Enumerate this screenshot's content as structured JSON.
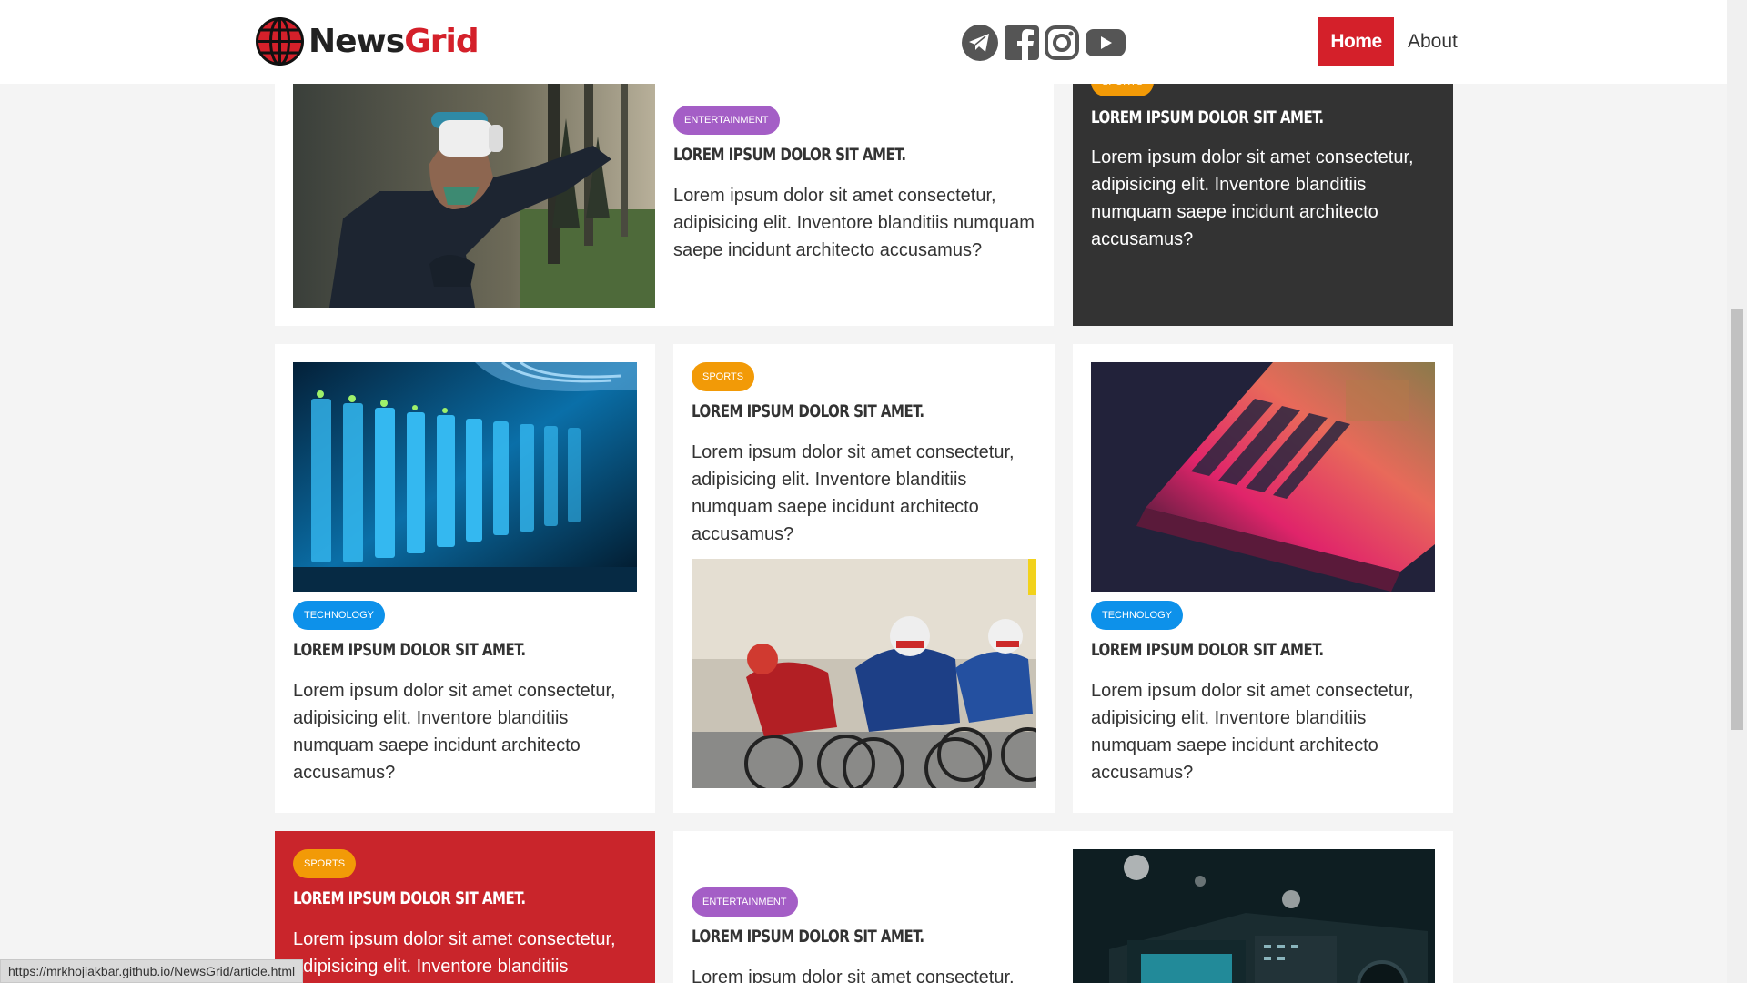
{
  "header": {
    "logo_news": "News",
    "logo_grid": "Grid",
    "nav": {
      "home": "Home",
      "about": "About"
    },
    "social": [
      "telegram-icon",
      "facebook-icon",
      "instagram-icon",
      "youtube-icon"
    ]
  },
  "cards": {
    "c1": {
      "category": "ENTERTAINMENT",
      "title": "LOREM IPSUM DOLOR SIT AMET.",
      "body": "Lorem ipsum dolor sit amet consectetur, adipisicing elit. Inventore blanditiis numquam saepe incidunt architecto accusamus?"
    },
    "c2": {
      "category": "SPORTS",
      "title": "LOREM IPSUM DOLOR SIT AMET.",
      "body": "Lorem ipsum dolor sit amet consectetur, adipisicing elit. Inventore blanditiis numquam saepe incidunt architecto accusamus?"
    },
    "c3": {
      "category": "TECHNOLOGY",
      "title": "LOREM IPSUM DOLOR SIT AMET.",
      "body": "Lorem ipsum dolor sit amet consectetur, adipisicing elit. Inventore blanditiis numquam saepe incidunt architecto accusamus?"
    },
    "c4": {
      "category": "SPORTS",
      "title": "LOREM IPSUM DOLOR SIT AMET.",
      "body": "Lorem ipsum dolor sit amet consectetur, adipisicing elit. Inventore blanditiis numquam saepe incidunt architecto accusamus?"
    },
    "c5": {
      "category": "TECHNOLOGY",
      "title": "LOREM IPSUM DOLOR SIT AMET.",
      "body": "Lorem ipsum dolor sit amet consectetur, adipisicing elit. Inventore blanditiis numquam saepe incidunt architecto accusamus?"
    },
    "c6": {
      "category": "SPORTS",
      "title": "LOREM IPSUM DOLOR SIT AMET.",
      "body": "Lorem ipsum dolor sit amet consectetur, adipisicing elit. Inventore blanditiis"
    },
    "c7": {
      "category": "ENTERTAINMENT",
      "title": "LOREM IPSUM DOLOR SIT AMET.",
      "body": "Lorem ipsum dolor sit amet consectetur,"
    }
  },
  "status_url": "https://mrkhojiakbar.github.io/NewsGrid/article.html",
  "colors": {
    "brand_red": "#d4202a",
    "entertainment": "#a45ec6",
    "sports": "#f29a07",
    "technology": "#0d91ea",
    "dark_card": "#333333"
  }
}
